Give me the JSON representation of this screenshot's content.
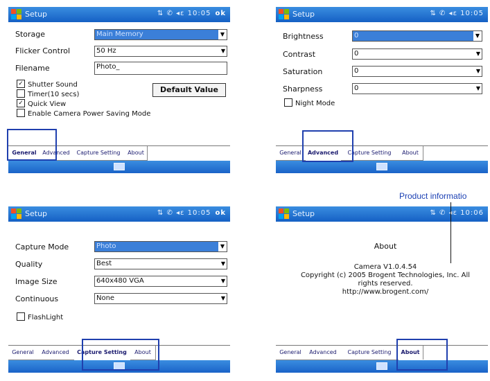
{
  "title": "Setup",
  "status_icons": "⇅ ✆ ◂ε",
  "panels": {
    "general": {
      "time": "10:05",
      "ok_label": "ok",
      "storage_label": "Storage",
      "storage_value": "Main Memory",
      "flicker_label": "Flicker Control",
      "flicker_value": "50 Hz",
      "filename_label": "Filename",
      "filename_value": "Photo_",
      "default_button": "Default Value",
      "checkboxes": [
        {
          "label": "Shutter Sound",
          "checked": true
        },
        {
          "label": "Timer(10 secs)",
          "checked": false
        },
        {
          "label": "Quick View",
          "checked": true
        },
        {
          "label": "Enable Camera Power Saving Mode",
          "checked": false
        }
      ]
    },
    "advanced": {
      "time": "10:05",
      "brightness_label": "Brightness",
      "brightness_value": "0",
      "contrast_label": "Contrast",
      "contrast_value": "0",
      "saturation_label": "Saturation",
      "saturation_value": "0",
      "sharpness_label": "Sharpness",
      "sharpness_value": "0",
      "night_label": "Night Mode"
    },
    "capture": {
      "time": "10:05",
      "ok_label": "ok",
      "mode_label": "Capture Mode",
      "mode_value": "Photo",
      "quality_label": "Quality",
      "quality_value": "Best",
      "size_label": "Image Size",
      "size_value": "640x480 VGA",
      "continuous_label": "Continuous",
      "continuous_value": "None",
      "flash_label": "FlashLight"
    },
    "about": {
      "time": "10:06",
      "heading": "About",
      "line1": "Camera V1.0.4.54",
      "line2": "Copyright (c) 2005 Brogent Technologies, Inc. All",
      "line3": "rights reserved.",
      "line4": "http://www.brogent.com/"
    }
  },
  "tabs": {
    "general": "General",
    "advanced": "Advanced",
    "capture": "Capture Setting",
    "about": "About"
  },
  "callout": "Product informatio",
  "colors": {
    "titlebar": "#1560c4",
    "highlight": "#1f3fae",
    "selection": "#3b7fd8"
  }
}
